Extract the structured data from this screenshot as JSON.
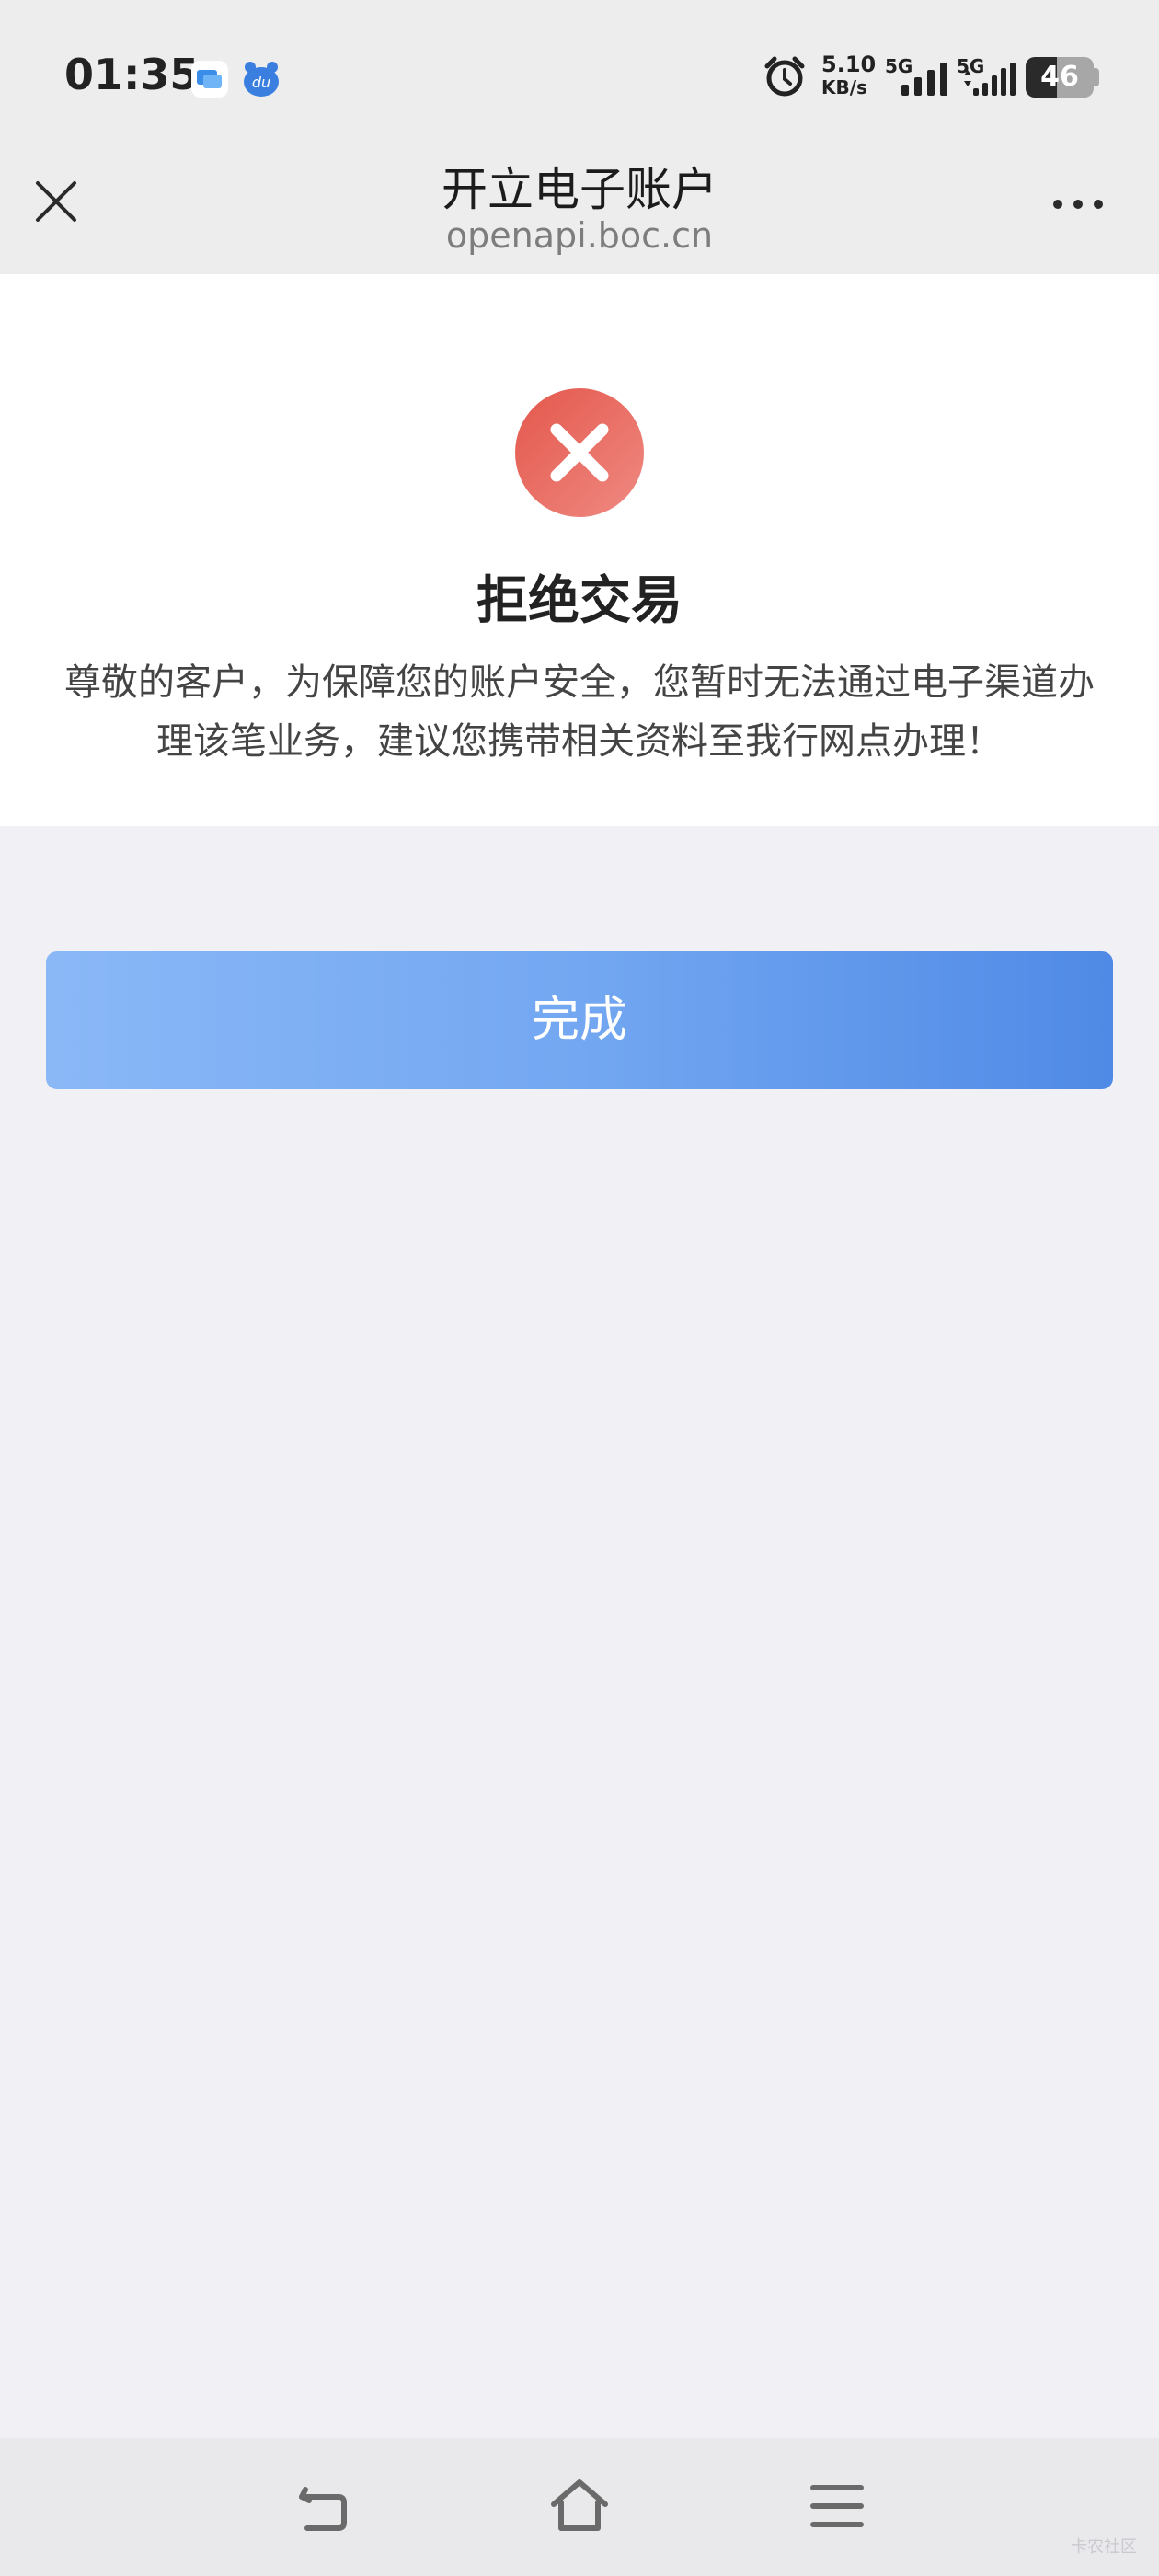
{
  "status_bar": {
    "time": "01:35",
    "net_speed": "5.10",
    "net_speed_unit": "KB/s",
    "sim1": "5G",
    "sim2": "5G",
    "battery": "46",
    "battery_level": 0.46
  },
  "nav": {
    "title": "开立电子账户",
    "subtitle": "openapi.boc.cn"
  },
  "result": {
    "title": "拒绝交易",
    "message": "尊敬的客户，为保障您的账户安全，您暂时无法通过电子渠道办理该笔业务，建议您携带相关资料至我行网点办理！",
    "icon": "error-x-icon",
    "icon_color": "#e8685e"
  },
  "done_button": {
    "label": "完成",
    "gradient_start": "#8ab8f7",
    "gradient_end": "#4f8ae6"
  },
  "bottom_nav": {
    "back": "back-icon",
    "home": "home-icon",
    "menu": "menu-icon"
  },
  "watermark": "卡农社区"
}
